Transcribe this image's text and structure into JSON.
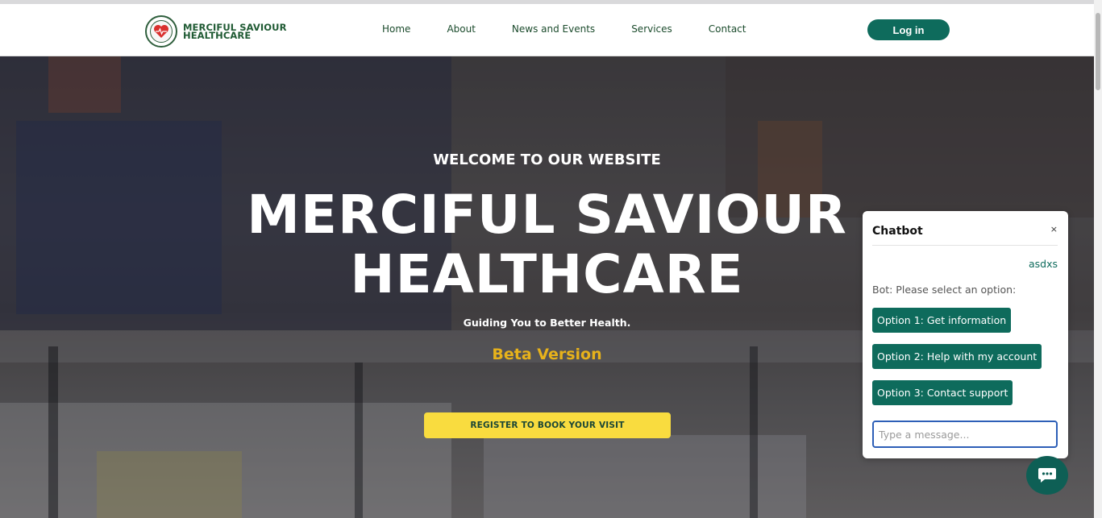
{
  "header": {
    "brand_line1": "MERCIFUL SAVIOUR",
    "brand_line2": "HEALTHCARE",
    "nav": [
      "Home",
      "About",
      "News and Events",
      "Services",
      "Contact"
    ],
    "login_label": "Log in"
  },
  "hero": {
    "welcome": "WELCOME TO OUR WEBSITE",
    "title_line1": "MERCIFUL SAVIOUR",
    "title_line2": "HEALTHCARE",
    "tagline": "Guiding You to Better Health.",
    "beta": "Beta Version",
    "register_label": "REGISTER TO BOOK YOUR VISIT"
  },
  "chatbot": {
    "title": "Chatbot",
    "close_symbol": "×",
    "user_message": "asdxs",
    "bot_message": "Bot: Please select an option:",
    "options": [
      "Option 1: Get information",
      "Option 2: Help with my account",
      "Option 3: Contact support"
    ],
    "input_placeholder": "Type a message..."
  },
  "colors": {
    "accent": "#0e6b5c",
    "brand_text": "#1f5a33",
    "beta": "#e7b21b",
    "register_button": "#f9dc3f",
    "input_focus": "#2d5fb7"
  },
  "icons": {
    "logo": "heart-badge-icon",
    "fab": "chat-bubble-icon"
  }
}
